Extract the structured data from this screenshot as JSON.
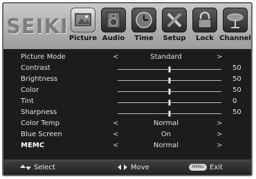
{
  "brand": "SEIKI",
  "tabs": [
    {
      "label": "Picture",
      "icon": "picture-icon",
      "active": true
    },
    {
      "label": "Audio",
      "icon": "audio-icon",
      "active": false
    },
    {
      "label": "Time",
      "icon": "clock-icon",
      "active": false
    },
    {
      "label": "Setup",
      "icon": "tools-icon",
      "active": false
    },
    {
      "label": "Lock",
      "icon": "lock-icon",
      "active": false
    },
    {
      "label": "Channel",
      "icon": "antenna-icon",
      "active": false
    }
  ],
  "menu": {
    "picture_mode": {
      "label": "Picture Mode",
      "value": "Standard"
    },
    "contrast": {
      "label": "Contrast",
      "value": "50",
      "level": 0.5
    },
    "brightness": {
      "label": "Brightness",
      "value": "50",
      "level": 0.5
    },
    "color": {
      "label": "Color",
      "value": "50",
      "level": 0.5
    },
    "tint": {
      "label": "Tint",
      "value": "0",
      "level": 0.5
    },
    "sharpness": {
      "label": "Sharpness",
      "value": "50",
      "level": 0.5
    },
    "color_temp": {
      "label": "Color Temp",
      "value": "Normal"
    },
    "blue_screen": {
      "label": "Blue Screen",
      "value": "On"
    },
    "memc": {
      "label": "MEMC",
      "value": "Normal"
    }
  },
  "arrows": {
    "left": "<",
    "right": ">"
  },
  "footer": {
    "select": "Select",
    "move": "Move",
    "menu_key": "MENU",
    "exit": "Exit"
  }
}
